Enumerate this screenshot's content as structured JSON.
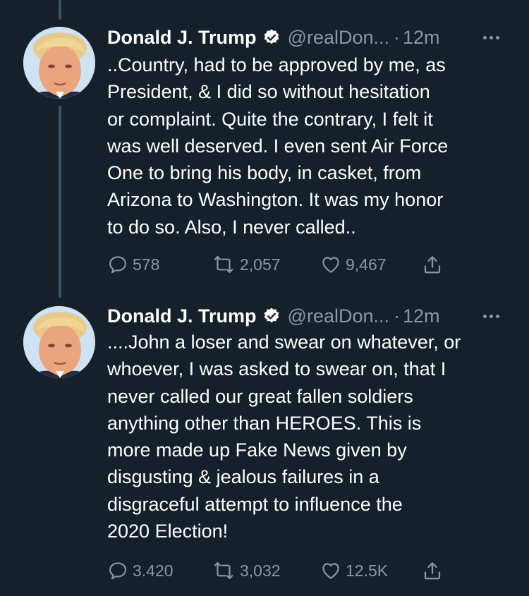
{
  "tweets": [
    {
      "author_name": "Donald J. Trump",
      "handle": "@realDon...",
      "dot": "·",
      "time": "12m",
      "text": "..Country, had to be approved by me, as\nPresident, & I did so without hesitation\nor complaint. Quite the contrary, I felt it\nwas well deserved. I even sent Air Force\nOne to bring his body, in casket, from\nArizona to Washington. It was my honor\nto do so. Also, I never called..",
      "replies": "578",
      "retweets": "2,057",
      "likes": "9,467"
    },
    {
      "author_name": "Donald J. Trump",
      "handle": "@realDon...",
      "dot": "·",
      "time": "12m",
      "text": "....John a loser and swear on whatever, or\nwhoever, I was asked to swear on, that I\nnever called our great fallen soldiers\nanything other than HEROES. This is\nmore made up Fake News given by\ndisgusting & jealous failures in a\ndisgraceful attempt to influence the\n2020 Election!",
      "replies": "3.420",
      "retweets": "3,032",
      "likes": "12.5K"
    }
  ],
  "icons": {
    "verified": "verified-badge-icon",
    "more": "more-horizontal-icon",
    "reply": "reply-bubble-icon",
    "retweet": "retweet-arrows-icon",
    "like": "heart-icon",
    "share": "share-upload-icon"
  },
  "colors": {
    "background": "#15202b",
    "primary_text": "#ffffff",
    "secondary_text": "#8899a6",
    "thread_line": "#3d5466"
  }
}
